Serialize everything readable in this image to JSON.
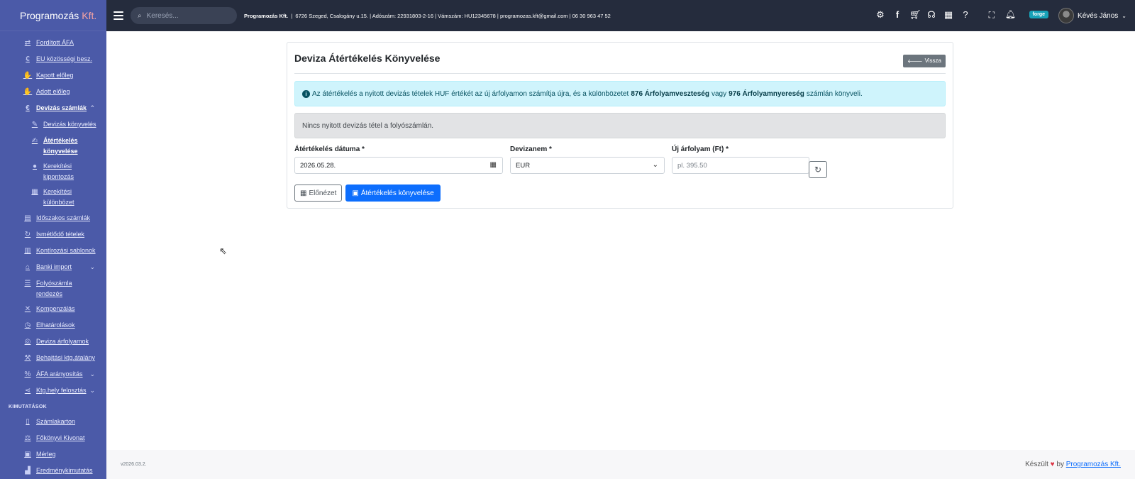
{
  "brand": {
    "name": "Programozás",
    "accent": "Kft."
  },
  "sidebar": {
    "items": [
      {
        "label": "Fordított ÁFA",
        "icon": "arrows-exchange-icon"
      },
      {
        "label": "EU közösségi besz.",
        "icon": "euro-circle-icon"
      },
      {
        "label": "Kapott előleg",
        "icon": "hand-coin-icon"
      },
      {
        "label": "Adott előleg",
        "icon": "hand-coin-icon"
      },
      {
        "label": "Devizás számlák",
        "icon": "euro-icon"
      },
      {
        "label": "Devizás könyvelés",
        "icon": "pen-icon"
      },
      {
        "label": "Átértékelés könyvelése",
        "icon": "edit-icon"
      },
      {
        "label": "Kerekítési kipontozás",
        "icon": "circle-icon"
      },
      {
        "label": "Kerekítési különbözet",
        "icon": "calculator-icon"
      },
      {
        "label": "Időszakos számlák",
        "icon": "calendar-icon"
      },
      {
        "label": "Ismétlődő tételek",
        "icon": "repeat-icon"
      },
      {
        "label": "Kontírozási sablonok",
        "icon": "clipboard-icon"
      },
      {
        "label": "Banki import",
        "icon": "bank-icon"
      },
      {
        "label": "Folyószámla rendezés",
        "icon": "list-icon"
      },
      {
        "label": "Kompenzálás",
        "icon": "compress-icon"
      },
      {
        "label": "Elhatárolások",
        "icon": "clock-icon"
      },
      {
        "label": "Deviza árfolyamok",
        "icon": "coins-icon"
      },
      {
        "label": "Behajtási ktg.átalány",
        "icon": "gavel-icon"
      },
      {
        "label": "ÁFA arányosítás",
        "icon": "percent-icon"
      },
      {
        "label": "Ktg.hely felosztás",
        "icon": "share-icon"
      }
    ],
    "section_label": "KIMUTATÁSOK",
    "report_items": [
      {
        "label": "Számlakarton",
        "icon": "file-icon"
      },
      {
        "label": "Főkönyvi Kivonat",
        "icon": "scale-icon"
      },
      {
        "label": "Mérleg",
        "icon": "table-icon"
      },
      {
        "label": "Eredménykimutatás",
        "icon": "chart-icon"
      }
    ]
  },
  "topbar": {
    "search_placeholder": "Keresés...",
    "company_name": "Programozás Kft.",
    "company_details": "6726 Szeged, Csalogány u.15.  |  Adószám: 22931803-2-16  |  Vámszám: HU12345678  |  programozas.kft@gmail.com  |  06 30 963 47 52",
    "badge": "forge",
    "user_name": "Kévés János"
  },
  "card": {
    "title": "Deviza Átértékelés Könyvelése",
    "back_label": "Vissza",
    "info_prefix": "Az átértékelés a nyitott devizás tételek HUF értékét az új árfolyamon számítja újra, és a különbözetet",
    "info_loss": "876 Árfolyamveszteség",
    "info_middle": "vagy",
    "info_gain": "976 Árfolyamnyereség",
    "info_suffix": "számlán könyveli.",
    "empty_message": "Nincs nyitott devizás tétel a folyószámlán.",
    "date_label": "Átértékelés dátuma *",
    "date_value": "2026.05.28.",
    "currency_label": "Devizanem *",
    "currency_value": "EUR",
    "rate_label": "Új árfolyam (Ft) *",
    "rate_placeholder": "pl. 395.50",
    "preview_label": "Előnézet",
    "submit_label": "Átértékelés könyvelése"
  },
  "footer": {
    "version": "v2026.03.2.",
    "made_prefix": "Készült",
    "made_by": "by",
    "made_link": "Programozás Kft."
  }
}
